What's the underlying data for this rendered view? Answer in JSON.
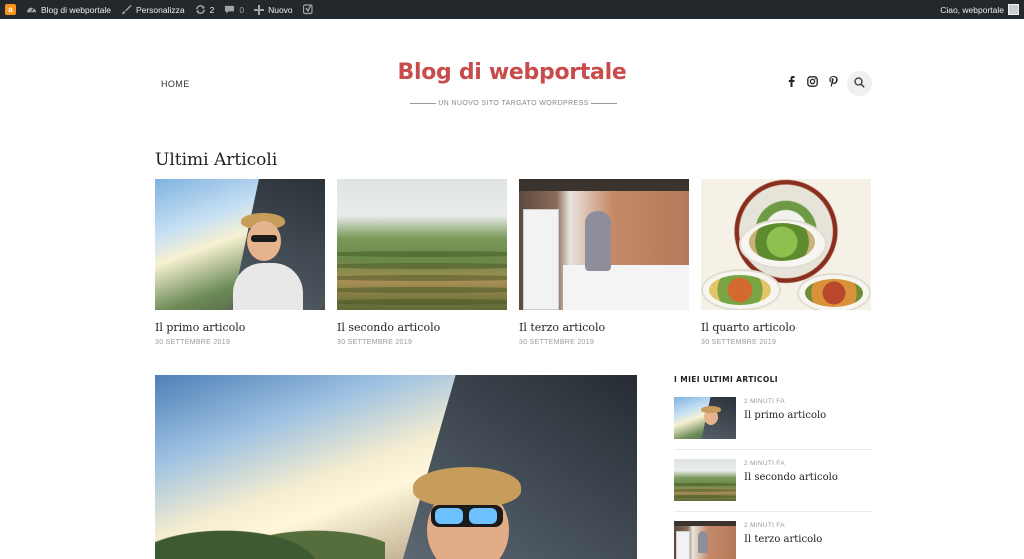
{
  "adminbar": {
    "logo_text": "a",
    "site_name": "Blog di webportale",
    "customize": "Personalizza",
    "updates_count": "2",
    "comments_count": "0",
    "new": "Nuovo",
    "greeting": "Ciao, webportale"
  },
  "header": {
    "nav_home": "HOME",
    "site_title": "Blog di webportale",
    "tagline": "UN NUOVO SITO TARGATO WORDPRESS",
    "accent_color": "#c84c4c"
  },
  "section": {
    "title": "Ultimi Articoli"
  },
  "posts": [
    {
      "title": "Il primo articolo",
      "date": "30 SETTEMBRE 2019"
    },
    {
      "title": "Il secondo articolo",
      "date": "30 SETTEMBRE 2019"
    },
    {
      "title": "Il terzo articolo",
      "date": "30 SETTEMBRE 2019"
    },
    {
      "title": "Il quarto articolo",
      "date": "30 SETTEMBRE 2019"
    }
  ],
  "sidebar": {
    "title": "I MIEI ULTIMI ARTICOLI",
    "items": [
      {
        "time": "2 MINUTI FA",
        "title": "Il primo articolo"
      },
      {
        "time": "2 MINUTI FA",
        "title": "Il secondo articolo"
      },
      {
        "time": "2 MINUTI FA",
        "title": "Il terzo articolo"
      }
    ]
  }
}
